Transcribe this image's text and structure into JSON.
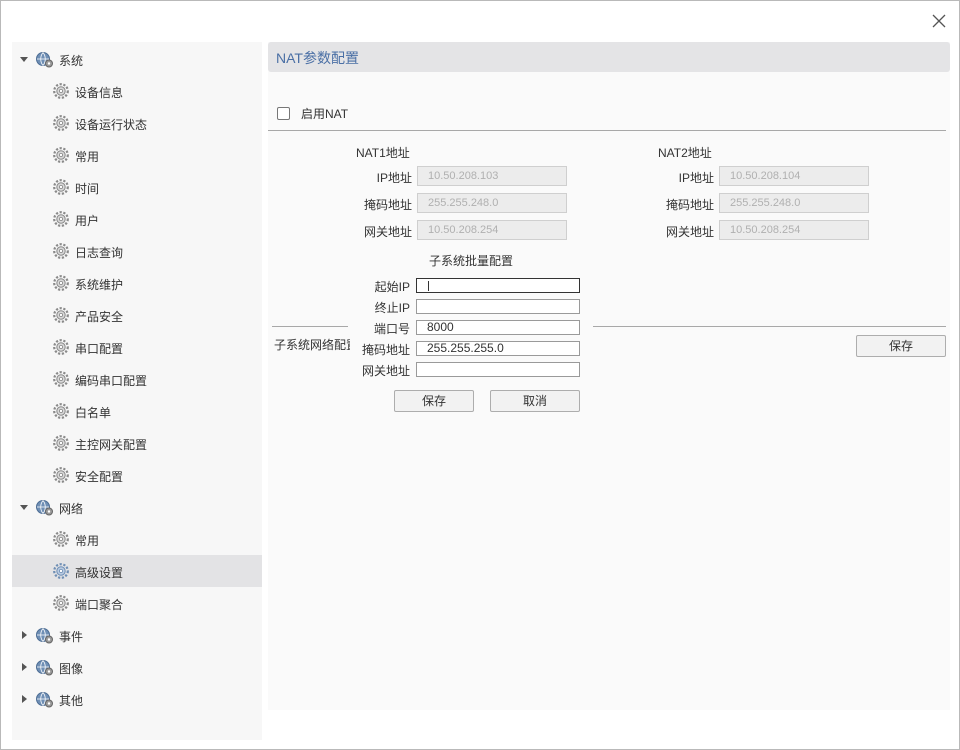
{
  "sidebar": {
    "groups": [
      {
        "label": "系统",
        "items": [
          {
            "label": "设备信息"
          },
          {
            "label": "设备运行状态"
          },
          {
            "label": "常用"
          },
          {
            "label": "时间"
          },
          {
            "label": "用户"
          },
          {
            "label": "日志查询"
          },
          {
            "label": "系统维护"
          },
          {
            "label": "产品安全"
          },
          {
            "label": "串口配置"
          },
          {
            "label": "编码串口配置"
          },
          {
            "label": "白名单"
          },
          {
            "label": "主控网关配置"
          },
          {
            "label": "安全配置"
          }
        ]
      },
      {
        "label": "网络",
        "items": [
          {
            "label": "常用"
          },
          {
            "label": "高级设置",
            "selected": true
          },
          {
            "label": "端口聚合"
          }
        ]
      },
      {
        "label": "事件",
        "items": []
      },
      {
        "label": "图像",
        "items": []
      },
      {
        "label": "其他",
        "items": []
      }
    ]
  },
  "main": {
    "title": "NAT参数配置",
    "enable_label": "启用NAT",
    "nat1": {
      "title": "NAT1地址",
      "ip_label": "IP地址",
      "ip": "10.50.208.103",
      "mask_label": "掩码地址",
      "mask": "255.255.248.0",
      "gw_label": "网关地址",
      "gw": "10.50.208.254"
    },
    "nat2": {
      "title": "NAT2地址",
      "ip_label": "IP地址",
      "ip": "10.50.208.104",
      "mask_label": "掩码地址",
      "mask": "255.255.248.0",
      "gw_label": "网关地址",
      "gw": "10.50.208.254"
    },
    "batch": {
      "title": "子系统批量配置",
      "start_ip_label": "起始IP",
      "start_ip": "",
      "end_ip_label": "终止IP",
      "end_ip": "",
      "port_label": "端口号",
      "port": "8000",
      "mask_label": "掩码地址",
      "mask": "255.255.255.0",
      "gw_label": "网关地址",
      "gw": "",
      "save_label": "保存",
      "cancel_label": "取消"
    },
    "subsystem_label": "子系统网络配置",
    "save_label": "保存"
  },
  "colors": {
    "title": "#4a6fa5",
    "selected_row": "#e3e3e5",
    "header_bg": "#e4e4e6"
  }
}
